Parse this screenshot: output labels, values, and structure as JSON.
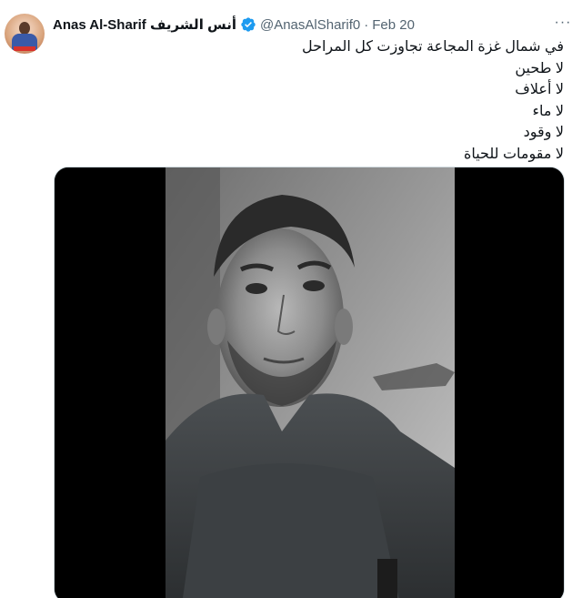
{
  "tweet": {
    "avatar_icon": "avatar",
    "display_name": "Anas Al-Sharif أنس الشريف",
    "verified_icon": "verified-badge-icon",
    "handle": "@AnasAlSharif0",
    "separator": "·",
    "date": "Feb 20",
    "more_icon": "more-options-icon",
    "more_label": "···",
    "text_lines": [
      "في شمال غزة المجاعة تجاوزت كل المراحل",
      "لا طحين",
      "لا أعلاف",
      "لا ماء",
      "لا وقود",
      "لا مقومات للحياة"
    ],
    "media": "video-thumbnail",
    "colors": {
      "verified": "#1d9bf0",
      "secondary_text": "#536471",
      "primary_text": "#0f1419"
    }
  }
}
